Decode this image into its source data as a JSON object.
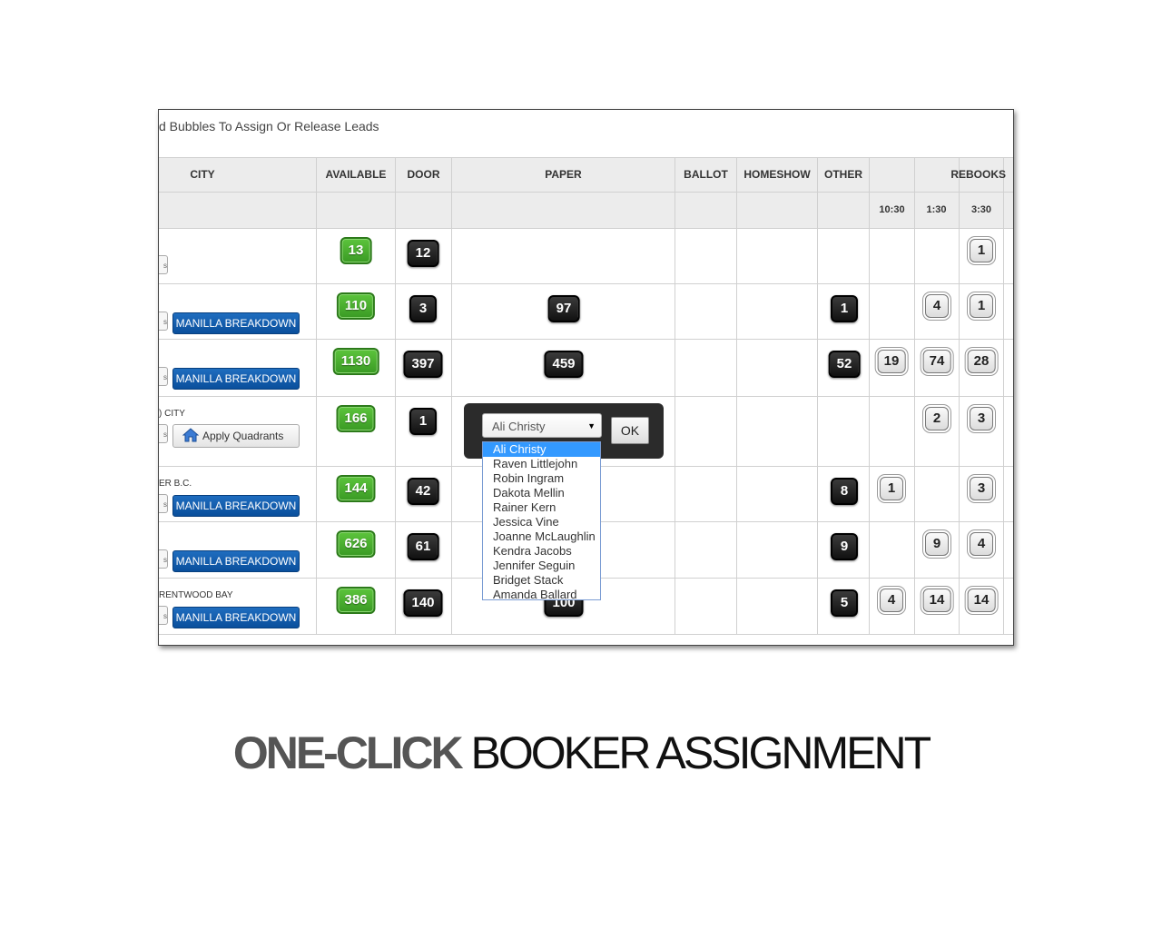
{
  "instruction": "d Bubbles To Assign Or Release Leads",
  "columns": {
    "city": "CITY",
    "available": "AVAILABLE",
    "door": "DOOR",
    "paper": "PAPER",
    "ballot": "BALLOT",
    "homeshow": "HOMESHOW",
    "other": "OTHER",
    "rebooks": "REBOOKS"
  },
  "rebook_times": [
    "10:30",
    "1:30",
    "3:30"
  ],
  "rows": [
    {
      "city": "",
      "button": "",
      "available": "13",
      "door": "12",
      "paper": "",
      "other": "",
      "r1": "",
      "r2": "",
      "r3": "1"
    },
    {
      "city": "",
      "button": "MANILLA BREAKDOWN",
      "available": "110",
      "door": "3",
      "paper": "97",
      "other": "1",
      "r1": "",
      "r2": "4",
      "r3": "1"
    },
    {
      "city": "",
      "button": "MANILLA BREAKDOWN",
      "available": "1130",
      "door": "397",
      "paper": "459",
      "other": "52",
      "r1": "19",
      "r2": "74",
      "r3": "28"
    },
    {
      "city": ") CITY",
      "button": "Apply Quadrants",
      "available": "166",
      "door": "1",
      "paper": "",
      "other": "",
      "r1": "",
      "r2": "2",
      "r3": "3"
    },
    {
      "city": "ER B.C.",
      "button": "MANILLA BREAKDOWN",
      "available": "144",
      "door": "42",
      "paper": "",
      "other": "8",
      "r1": "1",
      "r2": "",
      "r3": "3"
    },
    {
      "city": "",
      "button": "MANILLA BREAKDOWN",
      "available": "626",
      "door": "61",
      "paper": "",
      "other": "9",
      "r1": "",
      "r2": "9",
      "r3": "4"
    },
    {
      "city": "RENTWOOD BAY",
      "button": "MANILLA BREAKDOWN",
      "available": "386",
      "door": "140",
      "paper": "100",
      "other": "5",
      "r1": "4",
      "r2": "14",
      "r3": "14"
    }
  ],
  "assign_popup": {
    "selected": "Ali Christy",
    "ok_label": "OK",
    "options": [
      "Ali Christy",
      "Raven Littlejohn",
      "Robin Ingram",
      "Dakota Mellin",
      "Rainer Kern",
      "Jessica Vine",
      "Joanne McLaughlin",
      "Kendra Jacobs",
      "Jennifer Seguin",
      "Bridget Stack",
      "Amanda Ballard"
    ]
  },
  "caption": {
    "bold": "ONE-CLICK",
    "regular": " BOOKER ASSIGNMENT"
  },
  "colors": {
    "available": "#4caf2f",
    "dark_bubble": "#222222",
    "light_bubble": "#e8e8e8",
    "button_blue": "#0f5aa8",
    "highlight": "#3399ff"
  }
}
